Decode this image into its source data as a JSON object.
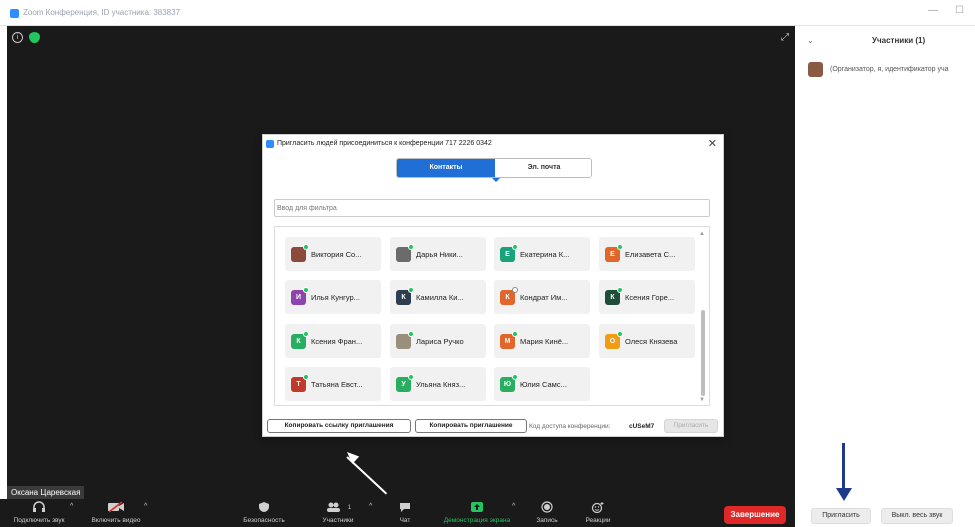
{
  "window": {
    "title": "Zoom Конференция, ID участника: 383837",
    "minimize": "—",
    "maximize": "☐"
  },
  "video": {
    "info_icon": "info-icon",
    "shield_icon": "shield-icon",
    "expand_icon": "expand-icon",
    "expand_glyph": "⤢",
    "user_name": "Оксана Царевская"
  },
  "toolbar": {
    "audio_label": "Подключить звук",
    "video_label": "Включить видео",
    "security_label": "Безопасность",
    "participants_label": "Участники",
    "participants_count": "1",
    "chat_label": "Чат",
    "share_label": "Демонстрация экрана",
    "record_label": "Запись",
    "reactions_label": "Реакции",
    "end_label": "Завершение",
    "accent_green": "#22c55e",
    "end_color": "#e02828"
  },
  "panel": {
    "collapse_glyph": "⌄",
    "title": "Участники (1)",
    "participant_role": "(Организатор, я, идентификатор уча",
    "invite_label": "Пригласить",
    "mute_all_label": "Выкл. весь звук"
  },
  "dialog": {
    "title": "Пригласить людей присоединиться к конференции 717 2226 0342",
    "close": "✕",
    "tabs": [
      {
        "label": "Контакты",
        "active": true
      },
      {
        "label": "Эл. почта",
        "active": false
      }
    ],
    "filter_placeholder": "Ввод для фильтра",
    "contacts": [
      {
        "name": "Виктория Со...",
        "initial": "",
        "color": "#8b4a3a",
        "photo": true,
        "online": true
      },
      {
        "name": "Дарья Ники...",
        "initial": "",
        "color": "#6b6b6b",
        "photo": true,
        "online": true
      },
      {
        "name": "Екатерина К...",
        "initial": "Е",
        "color": "#1aa37a",
        "photo": false,
        "online": true
      },
      {
        "name": "Елизавета С...",
        "initial": "Е",
        "color": "#e0662c",
        "photo": false,
        "online": true
      },
      {
        "name": "Илья Кунгур...",
        "initial": "И",
        "color": "#8e44ad",
        "photo": false,
        "online": true
      },
      {
        "name": "Камилла Ки...",
        "initial": "К",
        "color": "#2c3e50",
        "photo": false,
        "online": true
      },
      {
        "name": "Кондрат Им...",
        "initial": "К",
        "color": "#e0662c",
        "photo": false,
        "online": false
      },
      {
        "name": "Ксения Горе...",
        "initial": "К",
        "color": "#1e4d3a",
        "photo": false,
        "online": true
      },
      {
        "name": "Ксения Фран...",
        "initial": "К",
        "color": "#27ae60",
        "photo": false,
        "online": true
      },
      {
        "name": "Лариса Ручко",
        "initial": "",
        "color": "#9a8f7a",
        "photo": true,
        "online": true
      },
      {
        "name": "Мария Кинё...",
        "initial": "М",
        "color": "#e0662c",
        "photo": false,
        "online": true
      },
      {
        "name": "Олеся Князева",
        "initial": "О",
        "color": "#f39c12",
        "photo": false,
        "online": true
      },
      {
        "name": "Татьяна Евст...",
        "initial": "Т",
        "color": "#c0392b",
        "photo": false,
        "online": true
      },
      {
        "name": "Ульяна Княз...",
        "initial": "У",
        "color": "#27ae60",
        "photo": false,
        "online": true
      },
      {
        "name": "Юлия Самс...",
        "initial": "Ю",
        "color": "#27ae60",
        "photo": false,
        "online": true
      }
    ],
    "copy_link_label": "Копировать ссылку приглашения",
    "copy_invite_label": "Копировать приглашение",
    "access_code_label": "Код доступа конференции:",
    "access_code": "cUSeM7",
    "invite_label": "Пригласить"
  }
}
